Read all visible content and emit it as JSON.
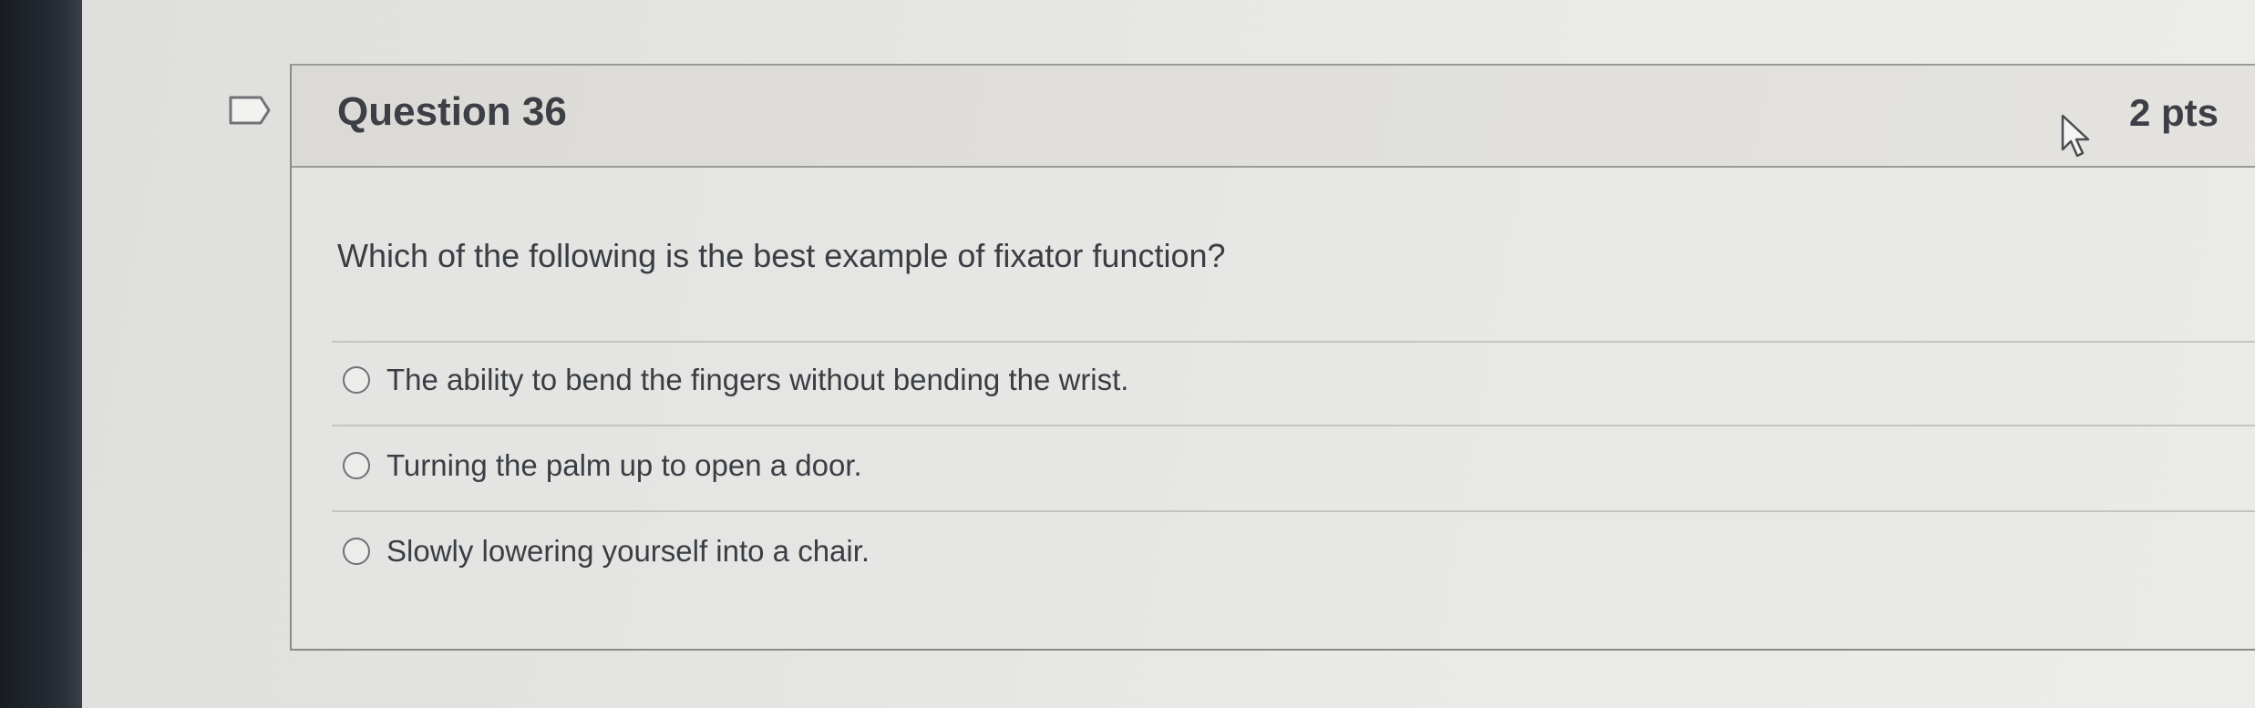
{
  "question": {
    "title": "Question 36",
    "points": "2 pts",
    "text": "Which of the following is the best example of fixator function?",
    "flag_icon": "bookmark-flag-icon",
    "answers": [
      {
        "label": "The ability to bend the fingers without bending the wrist.",
        "selected": false
      },
      {
        "label": "Turning the palm up to open a door.",
        "selected": false
      },
      {
        "label": "Slowly lowering yourself into a chair.",
        "selected": false
      }
    ]
  }
}
